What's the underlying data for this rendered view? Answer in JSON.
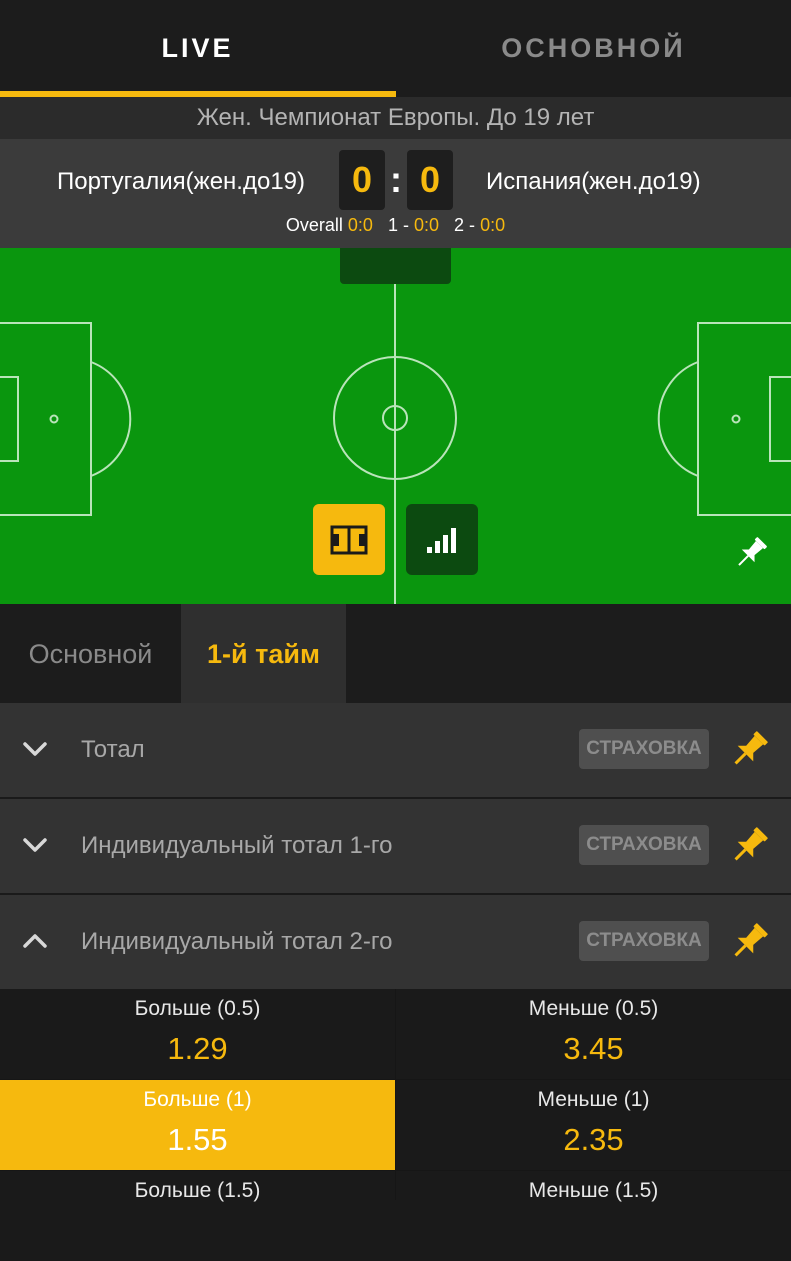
{
  "colors": {
    "accent": "#f6b90e",
    "field_green": "#0a960e",
    "dark_green": "#0c4a10",
    "panel": "#333333"
  },
  "top_tabs": {
    "live": "LIVE",
    "main": "ОСНОВНОЙ"
  },
  "league": "Жен. Чемпионат Европы. До 19 лет",
  "match": {
    "home_team": "Португалия(жен.до19)",
    "away_team": "Испания(жен.до19)",
    "home_score": "0",
    "away_score": "0",
    "separator": ":",
    "overall_label": "Overall",
    "overall_value": "0:0",
    "half1_label": "1 -",
    "half1_value": "0:0",
    "half2_label": "2 -",
    "half2_value": "0:0"
  },
  "field": {
    "view_button_icon": "field-icon",
    "stats_button_icon": "bar-chart-icon",
    "pin_icon": "pin-icon"
  },
  "sub_tabs": {
    "main": "Основной",
    "first_half": "1-й тайм"
  },
  "markets": [
    {
      "label": "Тотал",
      "badge": "СТРАХОВКА",
      "expanded": false
    },
    {
      "label": "Индивидуальный тотал 1-го",
      "badge": "СТРАХОВКА",
      "expanded": false
    },
    {
      "label": "Индивидуальный тотал 2-го",
      "badge": "СТРАХОВКА",
      "expanded": true
    }
  ],
  "odds": [
    {
      "label": "Больше (0.5)",
      "value": "1.29",
      "selected": false
    },
    {
      "label": "Меньше (0.5)",
      "value": "3.45",
      "selected": false
    },
    {
      "label": "Больше (1)",
      "value": "1.55",
      "selected": true
    },
    {
      "label": "Меньше (1)",
      "value": "2.35",
      "selected": false
    },
    {
      "label": "Больше (1.5)",
      "value": "",
      "selected": false
    },
    {
      "label": "Меньше (1.5)",
      "value": "",
      "selected": false
    }
  ]
}
